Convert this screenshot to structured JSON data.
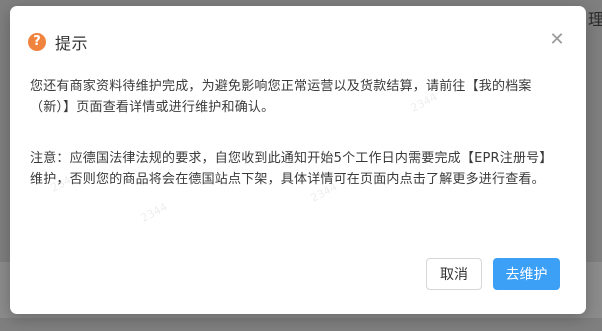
{
  "background": {
    "partial_text": "理"
  },
  "dialog": {
    "title": "提示",
    "paragraph1": "您还有商家资料待维护完成，为避免影响您正常运营以及货款结算，请前往【我的档案（新）】页面查看详情或进行维护和确认。",
    "paragraph2": "注意：应德国法律法规的要求，自您收到此通知开始5个工作日内需要完成【EPR注册号】维护，否则您的商品将会在德国站点下架，具体详情可在页面内点击了解更多进行查看。",
    "cancel_label": "取消",
    "confirm_label": "去维护",
    "icons": {
      "title_icon": "question-warning-icon",
      "close_icon": "close-icon"
    },
    "colors": {
      "primary": "#3da0f7",
      "warning_icon": "#f0843e"
    }
  }
}
